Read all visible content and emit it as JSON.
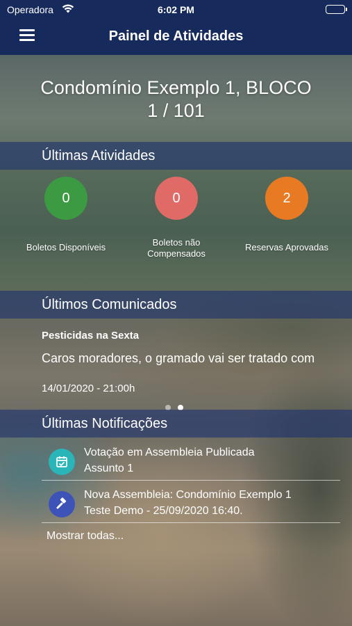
{
  "status_bar": {
    "carrier": "Operadora",
    "time": "6:02 PM"
  },
  "nav": {
    "title": "Painel de Atividades",
    "menu_icon": "hamburger-menu-icon",
    "bar_color": "#162a5c"
  },
  "condo": {
    "line1": "Condomínio Exemplo 1, BLOCO",
    "line2": "1 / 101"
  },
  "activities": {
    "header": "Últimas Atividades",
    "items": [
      {
        "value": "0",
        "label": "Boletos Disponíveis",
        "color": "#3c9a43"
      },
      {
        "value": "0",
        "label_line1": "Boletos não",
        "label_line2": "Compensados",
        "color": "#e06a66"
      },
      {
        "value": "2",
        "label": "Reservas Aprovadas",
        "color": "#e97a24"
      }
    ]
  },
  "announcements": {
    "header": "Últimos Comunicados",
    "title": "Pesticidas na Sexta",
    "body": "Caros moradores, o gramado vai ser tratado com",
    "date": "14/01/2020 - 21:00h",
    "pages": 2,
    "active_page": 2
  },
  "notifications": {
    "header": "Últimas Notificações",
    "items": [
      {
        "icon": "calendar-check-icon",
        "icon_color": "#2ab5b8",
        "line1": "Votação em Assembleia Publicada",
        "line2": "Assunto 1"
      },
      {
        "icon": "gavel-icon",
        "icon_color": "#3d53b8",
        "line1": "Nova Assembleia: Condomínio Exemplo 1",
        "line2": "Teste Demo - 25/09/2020 16:40."
      }
    ],
    "show_all": "Mostrar todas..."
  }
}
